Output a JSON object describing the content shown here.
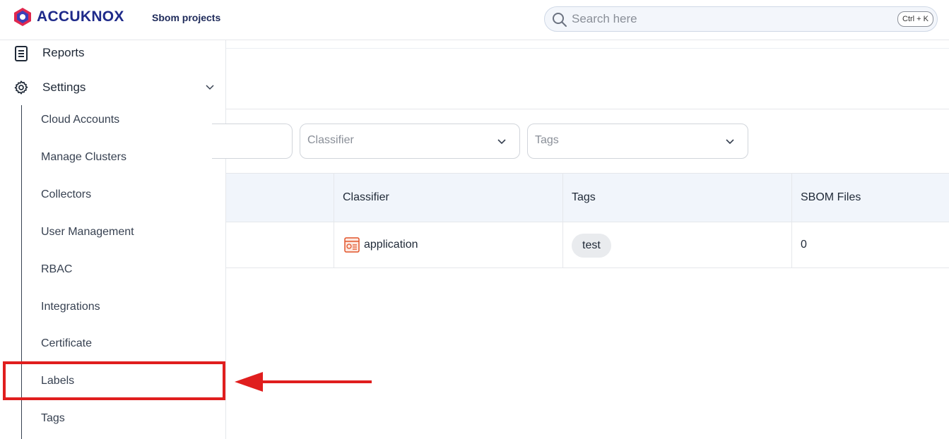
{
  "app": {
    "brand": "ACCUKNOX",
    "breadcrumb": "Sbom projects"
  },
  "search": {
    "placeholder": "Search here",
    "shortcut": "Ctrl + K"
  },
  "sidebar": {
    "reports_label": "Reports",
    "settings_label": "Settings",
    "sub_items": [
      "Cloud Accounts",
      "Manage Clusters",
      "Collectors",
      "User Management",
      "RBAC",
      "Integrations",
      "Certificate",
      "Labels",
      "Tags"
    ],
    "highlighted_item": "Labels"
  },
  "filters": {
    "classifier_placeholder": "Classifier",
    "tags_placeholder": "Tags"
  },
  "table": {
    "headers": [
      "Classifier",
      "Tags",
      "SBOM Files"
    ],
    "rows": [
      {
        "classifier": "application",
        "tag": "test",
        "sbom_files": "0"
      }
    ]
  },
  "colors": {
    "brand": "#1e2a8a",
    "annotation": "#e01e1e",
    "table_header_bg": "#f1f5fb"
  }
}
